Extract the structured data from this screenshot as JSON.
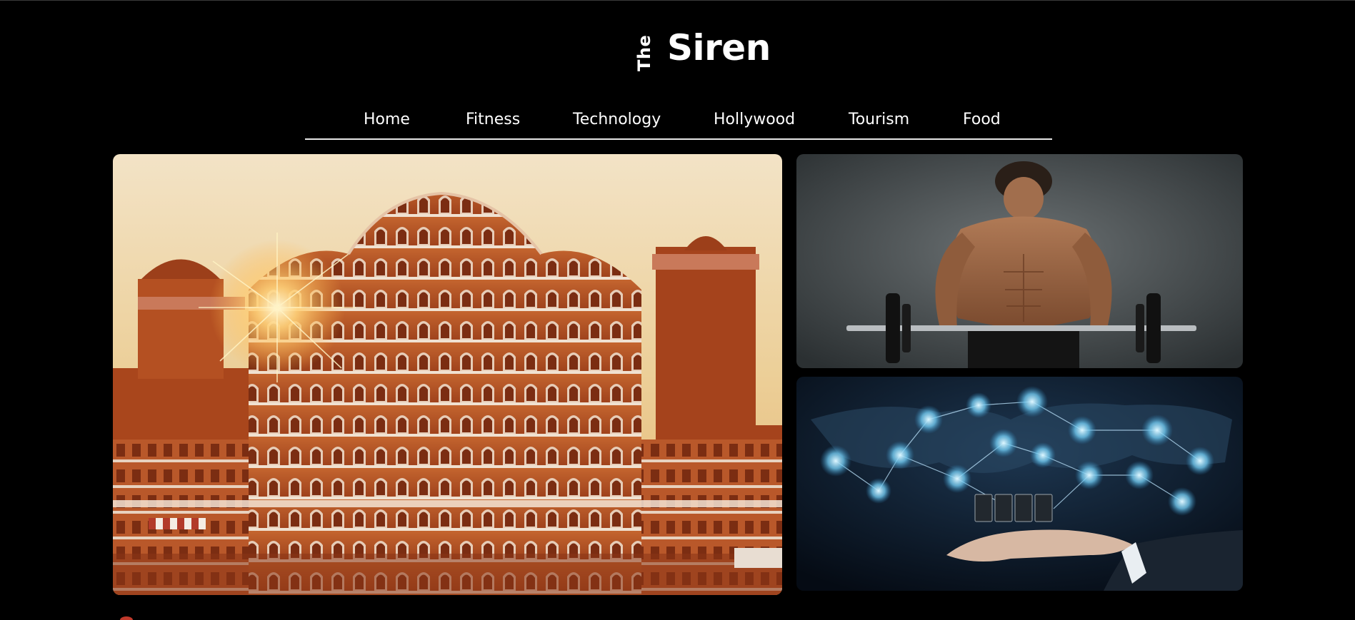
{
  "logo": {
    "prefix": "The",
    "name": "Siren"
  },
  "nav": {
    "items": [
      {
        "label": "Home"
      },
      {
        "label": "Fitness"
      },
      {
        "label": "Technology"
      },
      {
        "label": "Hollywood"
      },
      {
        "label": "Tourism"
      },
      {
        "label": "Food"
      }
    ]
  },
  "tiles": [
    {
      "icon": "palace-photo",
      "subject": "Hawa Mahal palace at sunset"
    },
    {
      "icon": "bodybuilder-photo",
      "subject": "Bodybuilder lifting barbell"
    },
    {
      "icon": "network-photo",
      "subject": "Hand with connected devices over world map"
    }
  ],
  "colors": {
    "background": "#000000",
    "text": "#ffffff",
    "nav_rule": "#e6e6e6"
  }
}
